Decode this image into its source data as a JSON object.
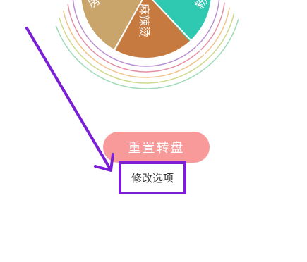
{
  "wheel": {
    "segments": [
      {
        "label": "房",
        "color": "#c9a46b"
      },
      {
        "label": "麻辣烫",
        "color": "#c77a3f"
      },
      {
        "label": "粉",
        "color": "#2ec9b0"
      }
    ],
    "ring_colors": [
      "#b98fd2",
      "#e38fa5",
      "#f2c38a",
      "#cfd98a",
      "#9ddbb9"
    ]
  },
  "actions": {
    "reset_label": "重置转盘",
    "modify_label": "修改选项"
  },
  "annotation": {
    "color": "#7b1fd6"
  }
}
